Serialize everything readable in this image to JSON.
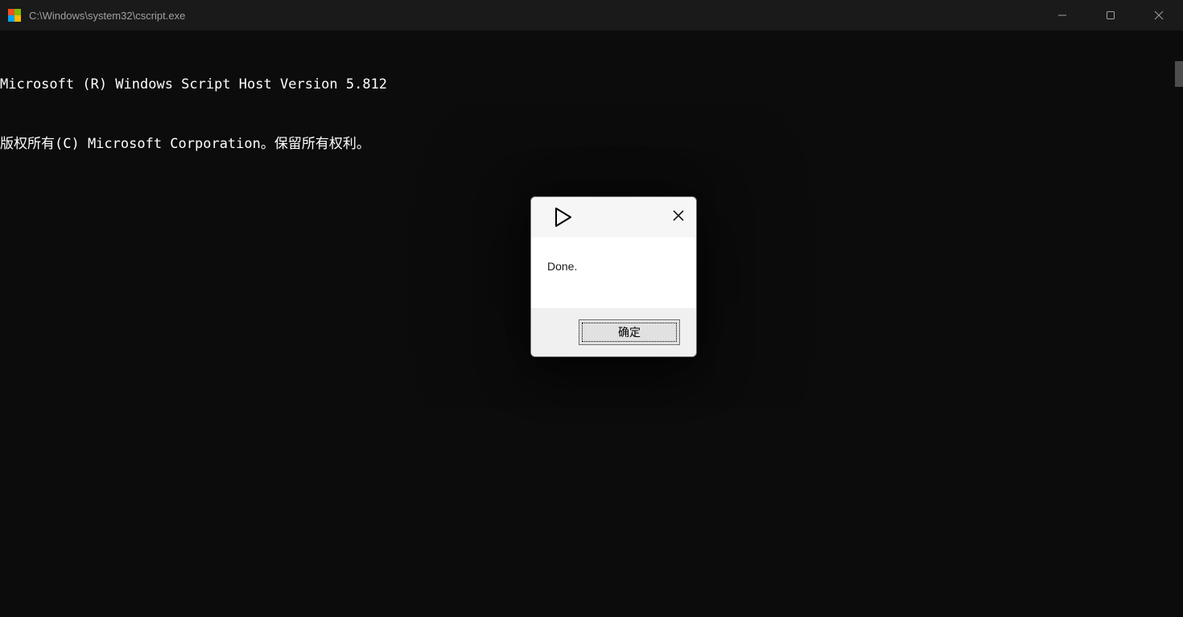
{
  "window": {
    "title": "C:\\Windows\\system32\\cscript.exe"
  },
  "console": {
    "line1": "Microsoft (R) Windows Script Host Version 5.812",
    "line2": "版权所有(C) Microsoft Corporation。保留所有权利。"
  },
  "dialog": {
    "message": "Done.",
    "ok_label": "确定"
  }
}
